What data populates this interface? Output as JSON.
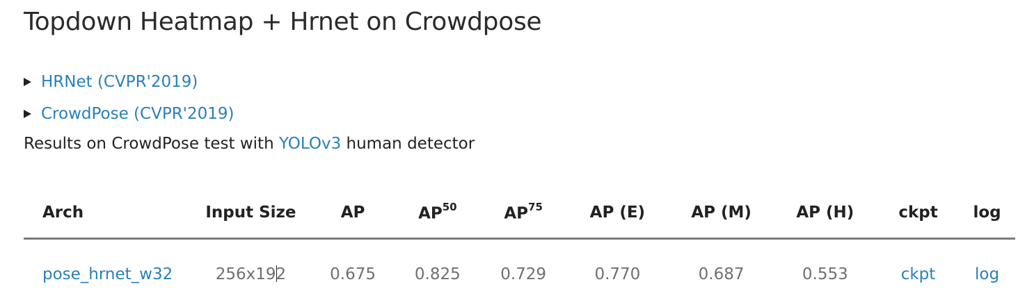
{
  "page": {
    "title": "Topdown Heatmap + Hrnet on Crowdpose"
  },
  "details": [
    {
      "label": "HRNet (CVPR'2019)"
    },
    {
      "label": "CrowdPose (CVPR'2019)"
    }
  ],
  "results_line": {
    "prefix": "Results on CrowdPose test with ",
    "link": "YOLOv3",
    "suffix": " human detector"
  },
  "table": {
    "headers": {
      "arch": "Arch",
      "input_size": "Input Size",
      "ap": "AP",
      "ap50_base": "AP",
      "ap50_sup": "50",
      "ap75_base": "AP",
      "ap75_sup": "75",
      "ap_e": "AP (E)",
      "ap_m": "AP (M)",
      "ap_h": "AP (H)",
      "ckpt": "ckpt",
      "log": "log"
    },
    "rows": [
      {
        "arch": "pose_hrnet_w32",
        "input_size_a": "256x19",
        "input_size_b": "2",
        "ap": "0.675",
        "ap50": "0.825",
        "ap75": "0.729",
        "ap_e": "0.770",
        "ap_m": "0.687",
        "ap_h": "0.553",
        "ckpt": "ckpt",
        "log": "log"
      }
    ]
  },
  "colors": {
    "link": "#2980b9",
    "text": "#222222",
    "muted": "#707070",
    "rule": "#7a7a7a"
  }
}
